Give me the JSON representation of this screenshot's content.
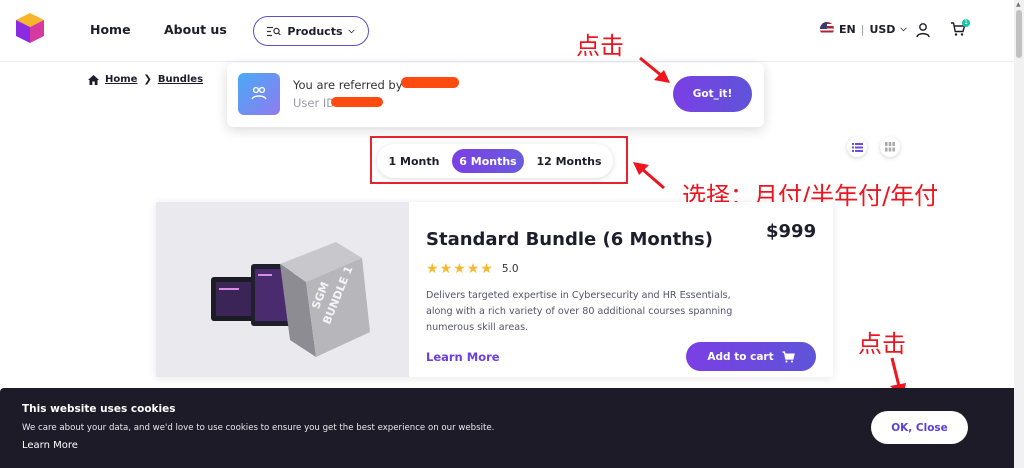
{
  "header": {
    "nav": {
      "home": "Home",
      "about": "About us",
      "products": "Products"
    },
    "locale": {
      "lang": "EN",
      "sep": "|",
      "currency": "USD"
    },
    "cart_count": "1"
  },
  "breadcrumb": {
    "home": "Home",
    "current": "Bundles"
  },
  "referral": {
    "line1": "You are referred by",
    "line2": "User ID",
    "button": "Got_it!"
  },
  "period": {
    "options": [
      "1 Month",
      "6 Months",
      "12 Months"
    ],
    "selected": "6 Months"
  },
  "product": {
    "title": "Standard Bundle (6 Months)",
    "price": "$999",
    "rating": "5.0",
    "stars": 5,
    "description": "Delivers targeted expertise in Cybersecurity and HR Essentials, along with a rich variety of over 80 additional courses spanning numerous skill areas.",
    "learn_more": "Learn More",
    "add_to_cart": "Add to cart",
    "box_label_line1": "SGM",
    "box_label_line2": "BUNDLE 1"
  },
  "cookie": {
    "title": "This website uses cookies",
    "text": "We care about your data, and we'd love to use cookies to ensure you get the best experience on our website.",
    "link": "Learn More",
    "button": "OK, Close"
  },
  "annotations": {
    "click_top": "点击",
    "choose": "选择：月付/半年付/年付",
    "click_bottom": "点击"
  },
  "colors": {
    "accent": "#6a4ce0",
    "annotation": "#f0141e",
    "redaction": "#ff4a10",
    "cookie_bg": "#1d1b27",
    "star": "#f5b82e"
  }
}
